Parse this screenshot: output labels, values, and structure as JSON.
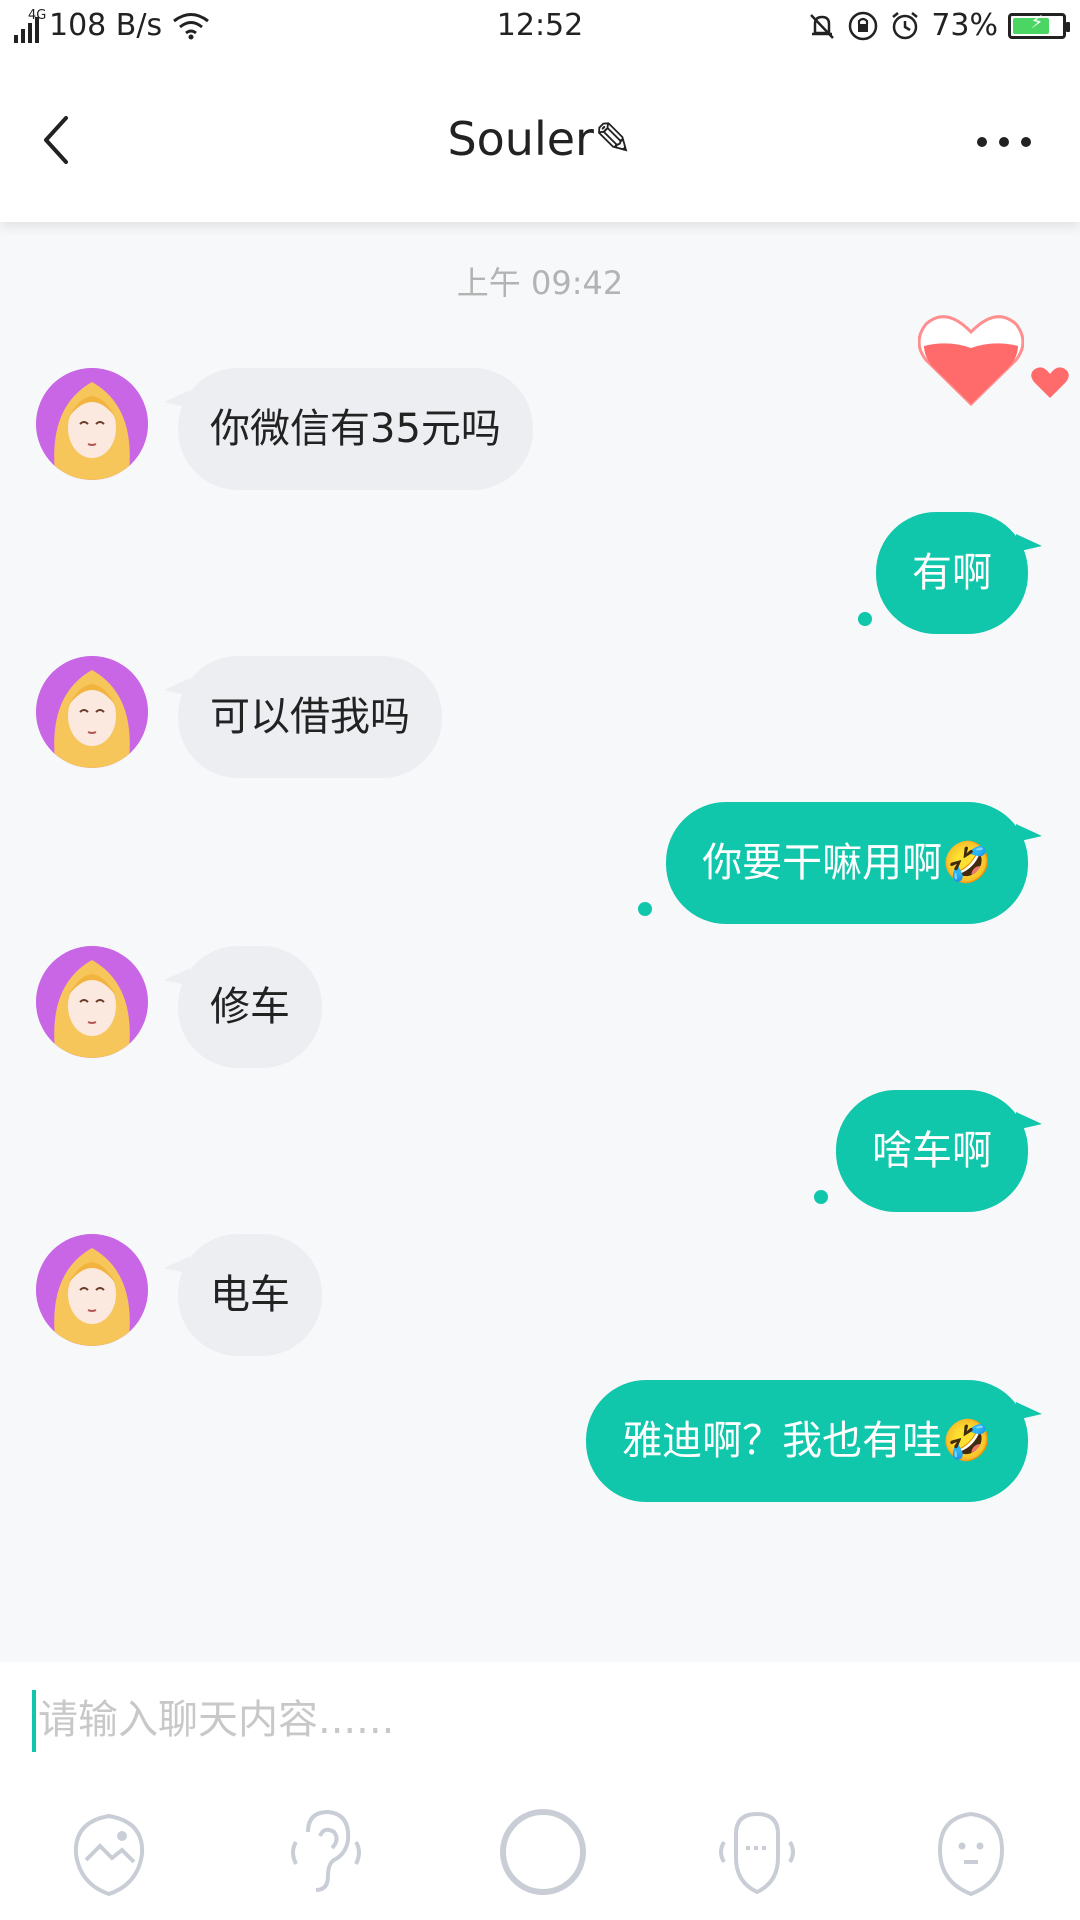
{
  "status": {
    "network": "4G",
    "speed": "108 B/s",
    "time": "12:52",
    "battery": "73%"
  },
  "header": {
    "title": "Souler✎"
  },
  "chat": {
    "timestamp": "上午 09:42",
    "messages": [
      {
        "side": "in",
        "text": "你微信有35元吗"
      },
      {
        "side": "out",
        "text": "有啊"
      },
      {
        "side": "in",
        "text": "可以借我吗"
      },
      {
        "side": "out",
        "text": "你要干嘛用啊🤣"
      },
      {
        "side": "in",
        "text": "修车"
      },
      {
        "side": "out",
        "text": "啥车啊"
      },
      {
        "side": "in",
        "text": "电车"
      },
      {
        "side": "out",
        "text": "雅迪啊？我也有哇🤣"
      }
    ]
  },
  "composer": {
    "placeholder": "请输入聊天内容......"
  },
  "toolbar": {
    "icons": [
      "image-icon",
      "ear-icon",
      "record-icon",
      "voice-icon",
      "face-icon"
    ]
  },
  "colors": {
    "accent": "#10c6ab",
    "bubble_in": "#eceef2",
    "heart": "#ff6b6b"
  }
}
